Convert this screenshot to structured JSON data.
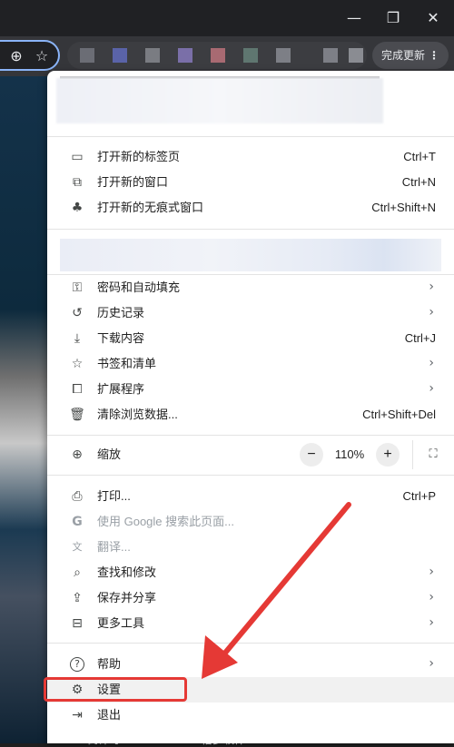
{
  "window": {
    "minimize_icon": "minimize-icon",
    "restore_icon": "restore-icon",
    "close_icon": "close-icon",
    "minimize_glyph": "—",
    "restore_glyph": "❐",
    "close_glyph": "✕"
  },
  "toolbar": {
    "zoom_glyph": "⊕",
    "star_glyph": "☆",
    "update_label": "完成更新",
    "update_menu_glyph": "⋮"
  },
  "menu": {
    "section1": [
      {
        "label": "打开新的标签页",
        "shortcut": "Ctrl+T",
        "icon": "new-tab-icon",
        "glyph": "▭"
      },
      {
        "label": "打开新的窗口",
        "shortcut": "Ctrl+N",
        "icon": "new-window-icon",
        "glyph": "⧉"
      },
      {
        "label": "打开新的无痕式窗口",
        "shortcut": "Ctrl+Shift+N",
        "icon": "incognito-icon",
        "glyph": "♣"
      }
    ],
    "section2": [
      {
        "label": "密码和自动填充",
        "shortcut": "",
        "icon": "key-icon",
        "glyph": "⚿",
        "chevron": "›"
      },
      {
        "label": "历史记录",
        "shortcut": "",
        "icon": "history-icon",
        "glyph": "↺",
        "chevron": "›"
      },
      {
        "label": "下载内容",
        "shortcut": "Ctrl+J",
        "icon": "download-icon",
        "glyph": "⤓"
      },
      {
        "label": "书签和清单",
        "shortcut": "",
        "icon": "bookmark-star-icon",
        "glyph": "☆",
        "chevron": "›"
      },
      {
        "label": "扩展程序",
        "shortcut": "",
        "icon": "extension-icon",
        "glyph": "⧠",
        "chevron": "›"
      },
      {
        "label": "清除浏览数据...",
        "shortcut": "Ctrl+Shift+Del",
        "icon": "trash-icon",
        "glyph": "🗑"
      }
    ],
    "zoom": {
      "label": "缩放",
      "value": "110%",
      "minus": "−",
      "plus": "+",
      "icon": "zoom-icon",
      "glyph": "⊕",
      "fullscreen_glyph": "⛶"
    },
    "section3": [
      {
        "label": "打印...",
        "shortcut": "Ctrl+P",
        "icon": "print-icon",
        "glyph": "⎙"
      },
      {
        "label": "使用 Google 搜索此页面...",
        "shortcut": "",
        "icon": "google-icon",
        "glyph": "G",
        "disabled": true
      },
      {
        "label": "翻译...",
        "shortcut": "",
        "icon": "translate-icon",
        "glyph": "文",
        "disabled": true
      },
      {
        "label": "查找和修改",
        "shortcut": "",
        "icon": "find-icon",
        "glyph": "⌕",
        "chevron": "›"
      },
      {
        "label": "保存并分享",
        "shortcut": "",
        "icon": "save-share-icon",
        "glyph": "⇪",
        "chevron": "›"
      },
      {
        "label": "更多工具",
        "shortcut": "",
        "icon": "toolbox-icon",
        "glyph": "⊟",
        "chevron": "›"
      }
    ],
    "section4": [
      {
        "label": "帮助",
        "shortcut": "",
        "icon": "help-icon",
        "glyph": "?",
        "chevron": "›"
      },
      {
        "label": "设置",
        "shortcut": "",
        "icon": "settings-gear-icon",
        "glyph": "⚙",
        "highlight": true
      },
      {
        "label": "退出",
        "shortcut": "",
        "icon": "exit-icon",
        "glyph": "⇥"
      }
    ]
  },
  "background": {
    "text_left": "倒计时",
    "text_right": "倍多软件"
  },
  "colors": {
    "annotation_red": "#e53935",
    "omnibox_focus": "#8ab4f8"
  }
}
